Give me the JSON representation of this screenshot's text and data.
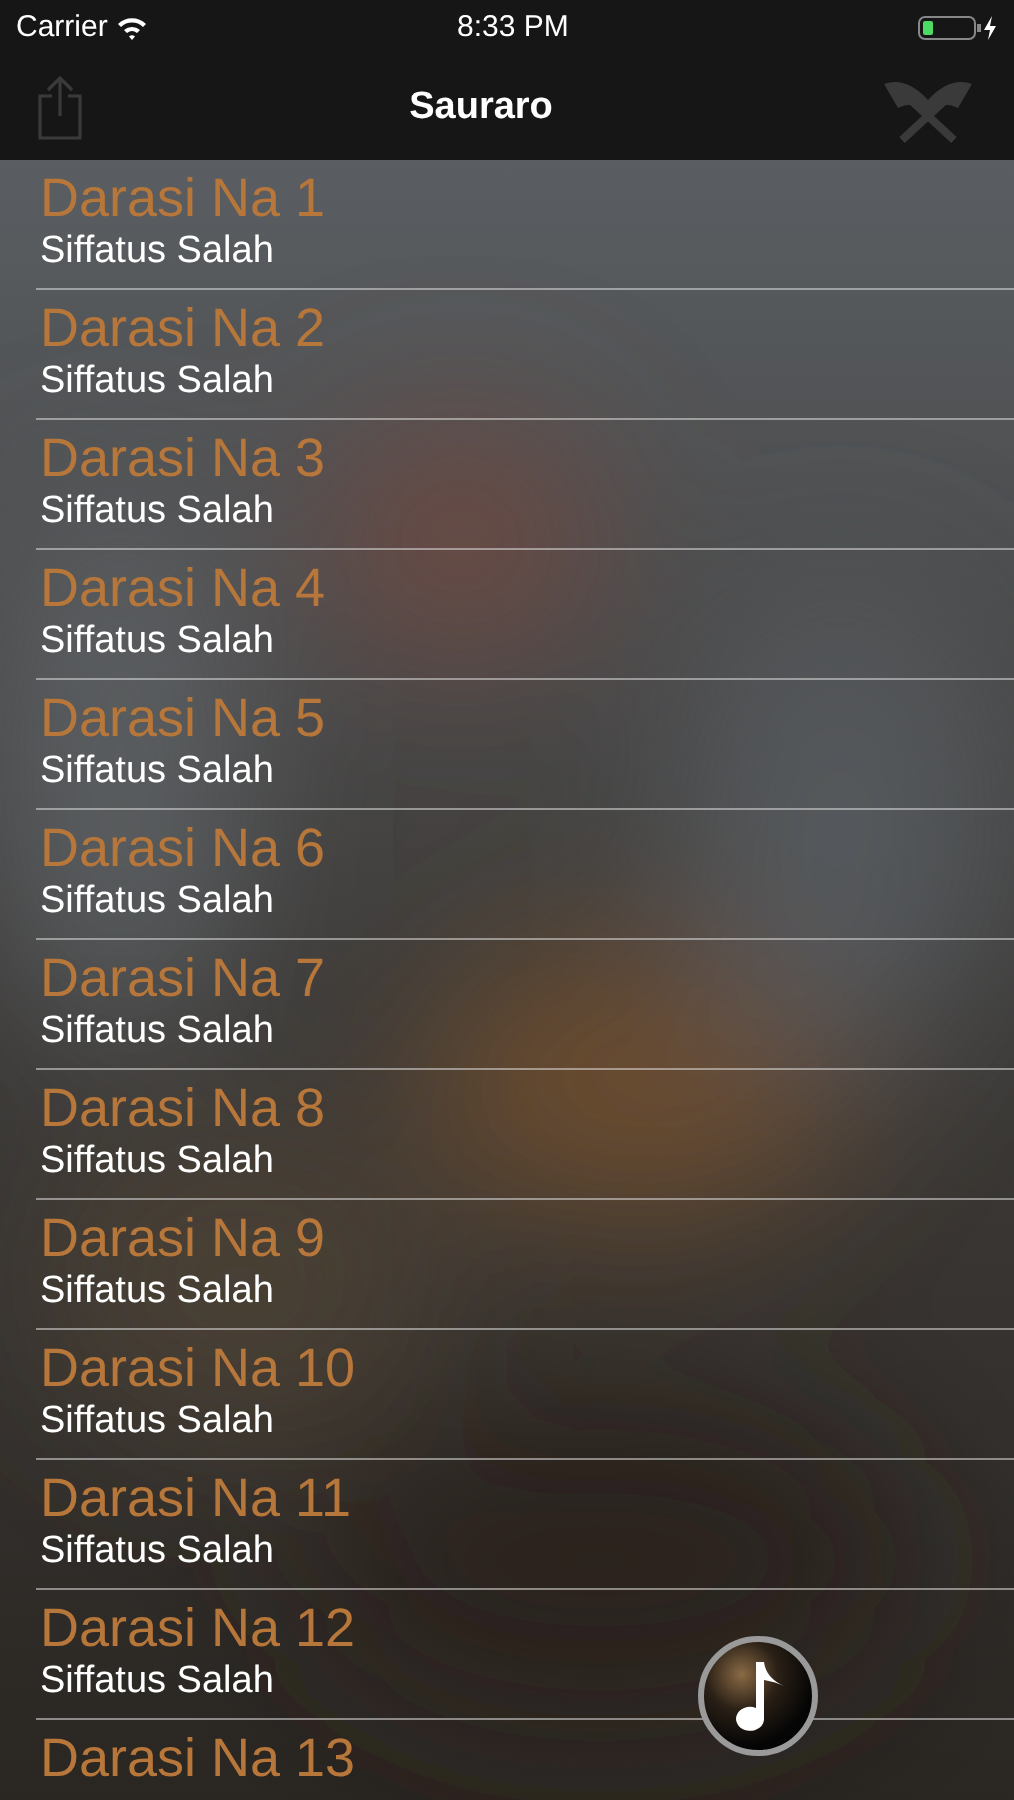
{
  "status_bar": {
    "carrier": "Carrier",
    "time": "8:33 PM"
  },
  "nav_bar": {
    "title": "Sauraro"
  },
  "lessons": [
    {
      "title": "Darasi Na 1",
      "subtitle": "Siffatus Salah"
    },
    {
      "title": "Darasi Na 2",
      "subtitle": "Siffatus Salah"
    },
    {
      "title": "Darasi Na 3",
      "subtitle": "Siffatus Salah"
    },
    {
      "title": "Darasi Na 4",
      "subtitle": "Siffatus Salah"
    },
    {
      "title": "Darasi Na 5",
      "subtitle": "Siffatus Salah"
    },
    {
      "title": "Darasi Na 6",
      "subtitle": "Siffatus Salah"
    },
    {
      "title": "Darasi Na 7",
      "subtitle": "Siffatus Salah"
    },
    {
      "title": "Darasi Na 8",
      "subtitle": "Siffatus Salah"
    },
    {
      "title": "Darasi Na 9",
      "subtitle": "Siffatus Salah"
    },
    {
      "title": "Darasi Na 10",
      "subtitle": "Siffatus Salah"
    },
    {
      "title": "Darasi Na 11",
      "subtitle": "Siffatus Salah"
    },
    {
      "title": "Darasi Na 12",
      "subtitle": "Siffatus Salah"
    },
    {
      "title": "Darasi Na 13"
    }
  ]
}
